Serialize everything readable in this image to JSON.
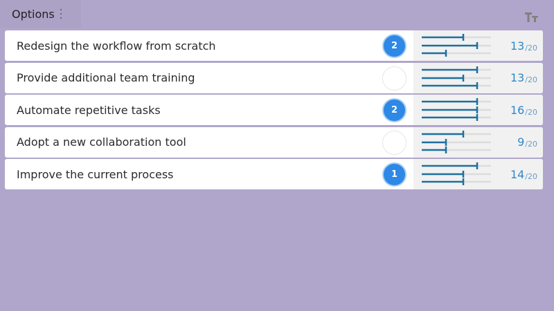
{
  "header": {
    "title": "Options"
  },
  "colors": {
    "background": "#b0a6cb",
    "accent": "#2e88e6",
    "bar": "#1e6f9e",
    "track": "#dcdcdc"
  },
  "options": [
    {
      "label": "Redesign the workflow from scratch",
      "rank": "2",
      "score": "13",
      "max": "/20",
      "bars": [
        0.6,
        0.8,
        0.35
      ]
    },
    {
      "label": "Provide additional team training",
      "rank": "",
      "score": "13",
      "max": "/20",
      "bars": [
        0.8,
        0.6,
        0.8
      ]
    },
    {
      "label": "Automate repetitive tasks",
      "rank": "2",
      "score": "16",
      "max": "/20",
      "bars": [
        0.8,
        0.8,
        0.8
      ]
    },
    {
      "label": "Adopt a new collaboration tool",
      "rank": "",
      "score": "9",
      "max": "/20",
      "bars": [
        0.6,
        0.35,
        0.35
      ]
    },
    {
      "label": "Improve the current process",
      "rank": "1",
      "score": "14",
      "max": "/20",
      "bars": [
        0.8,
        0.6,
        0.6
      ]
    }
  ]
}
